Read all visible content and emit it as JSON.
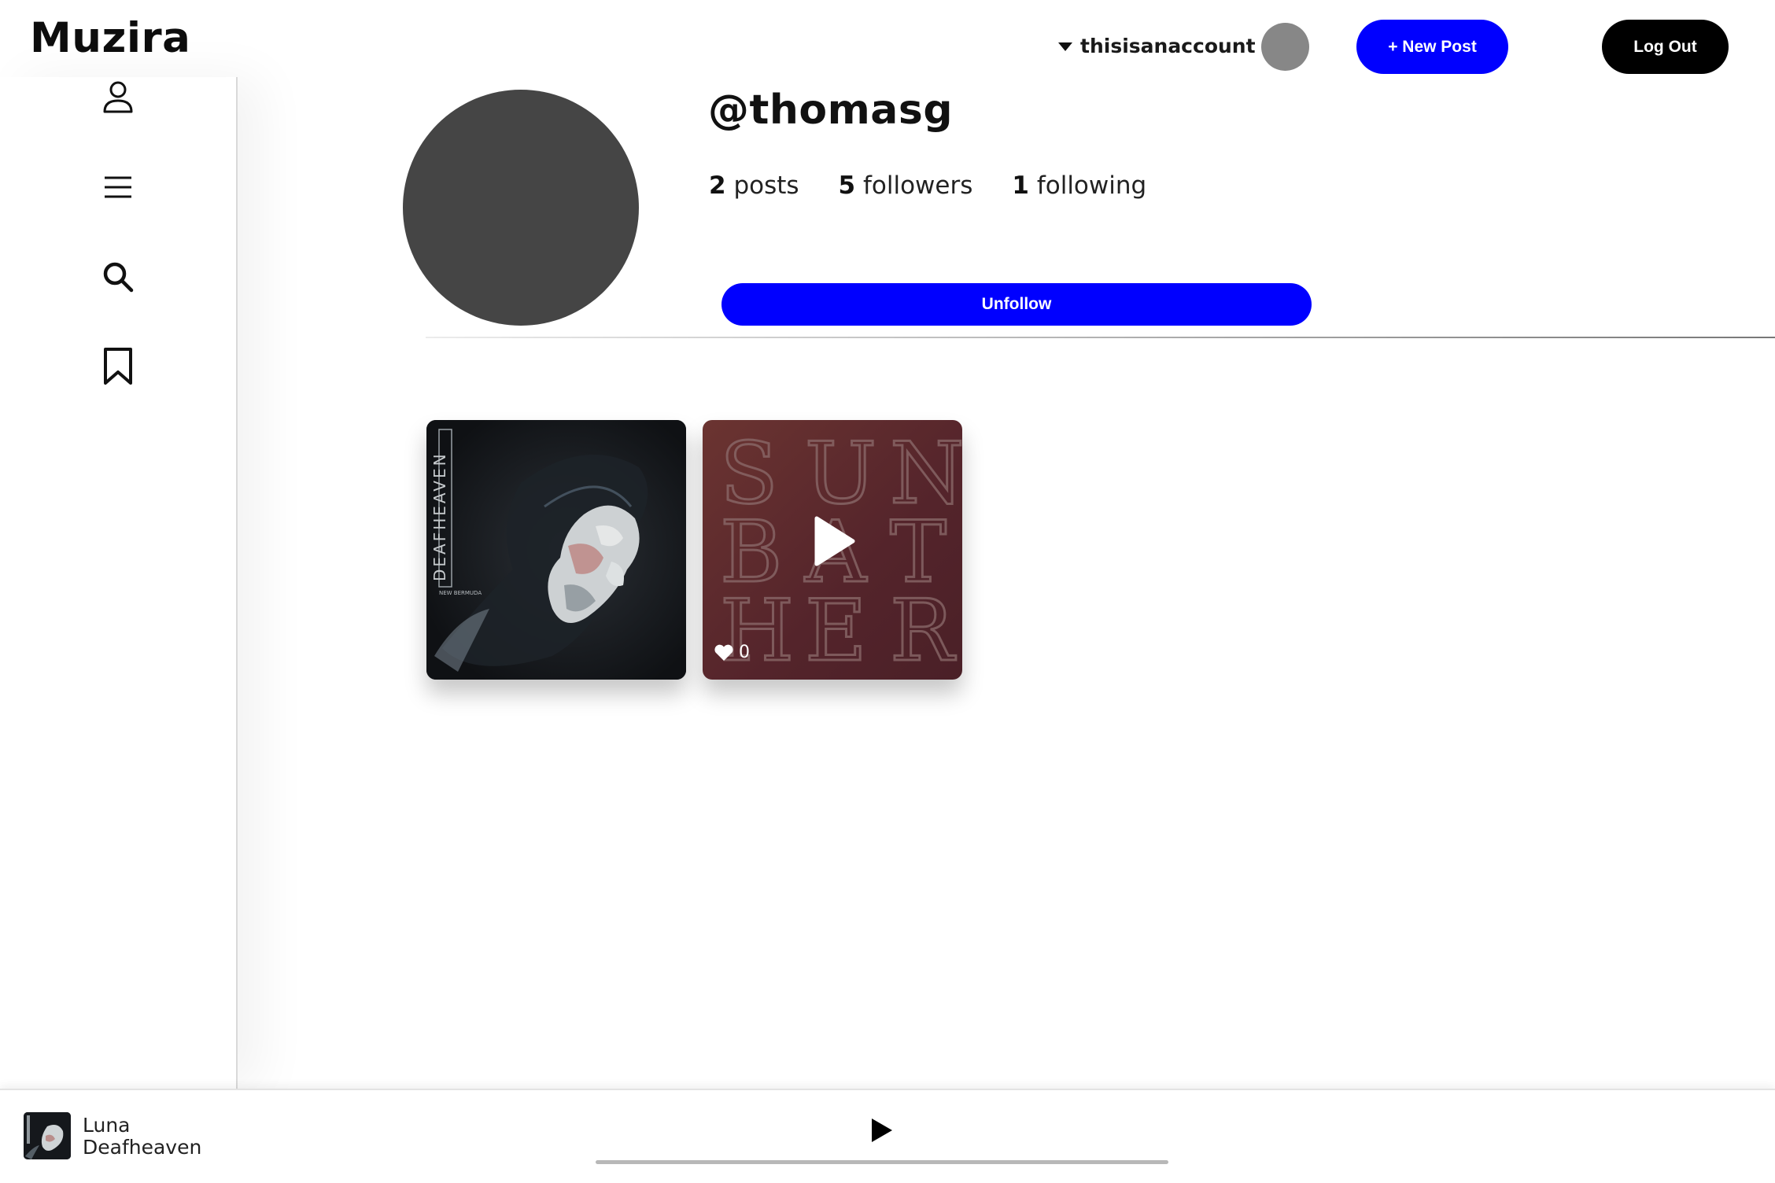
{
  "app": {
    "brand": "Muzira"
  },
  "topbar": {
    "account_name": "thisisanaccount",
    "new_post_label": "+ New Post",
    "logout_label": "Log Out"
  },
  "sidebar": {
    "items": [
      {
        "icon": "user-icon"
      },
      {
        "icon": "menu-icon"
      },
      {
        "icon": "search-icon"
      },
      {
        "icon": "bookmark-icon"
      }
    ]
  },
  "profile": {
    "handle": "@thomasg",
    "posts_count": "2",
    "posts_label": "posts",
    "followers_count": "5",
    "followers_label": "followers",
    "following_count": "1",
    "following_label": "following",
    "unfollow_label": "Unfollow"
  },
  "posts": [
    {
      "cover_text": "NEW BERMUDA"
    },
    {
      "cover_letters": [
        "S",
        "U",
        "N",
        "B",
        "A",
        "T",
        "H",
        "E",
        "R"
      ],
      "likes": "0"
    }
  ],
  "player": {
    "title": "Luna",
    "artist": "Deafheaven",
    "progress": 0
  },
  "colors": {
    "primary": "#0000ff",
    "dark": "#000000",
    "avatar_gray": "#454545",
    "post2_bg": "#5a2a2d"
  }
}
